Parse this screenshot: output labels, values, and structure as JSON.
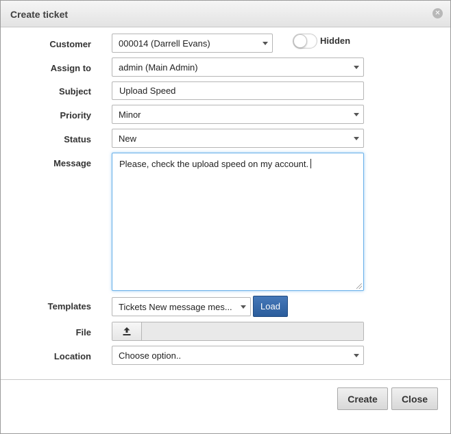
{
  "dialog": {
    "title": "Create ticket",
    "close_icon": "close-icon"
  },
  "form": {
    "customer": {
      "label": "Customer",
      "value": "000014 (Darrell Evans)"
    },
    "hidden_toggle": {
      "label": "Hidden",
      "state": "off"
    },
    "assign_to": {
      "label": "Assign to",
      "value": "admin (Main Admin)"
    },
    "subject": {
      "label": "Subject",
      "value": "Upload Speed"
    },
    "priority": {
      "label": "Priority",
      "value": "Minor"
    },
    "status": {
      "label": "Status",
      "value": "New"
    },
    "message": {
      "label": "Message",
      "value": "Please, check the upload speed on my account."
    },
    "templates": {
      "label": "Templates",
      "value": "Tickets New message mes...",
      "load_label": "Load"
    },
    "file": {
      "label": "File",
      "icon": "upload-icon"
    },
    "location": {
      "label": "Location",
      "value": "Choose option.."
    }
  },
  "footer": {
    "create_label": "Create",
    "close_label": "Close"
  },
  "colors": {
    "primary_button": "#2b5d9c",
    "focus_border": "#66afe9"
  }
}
